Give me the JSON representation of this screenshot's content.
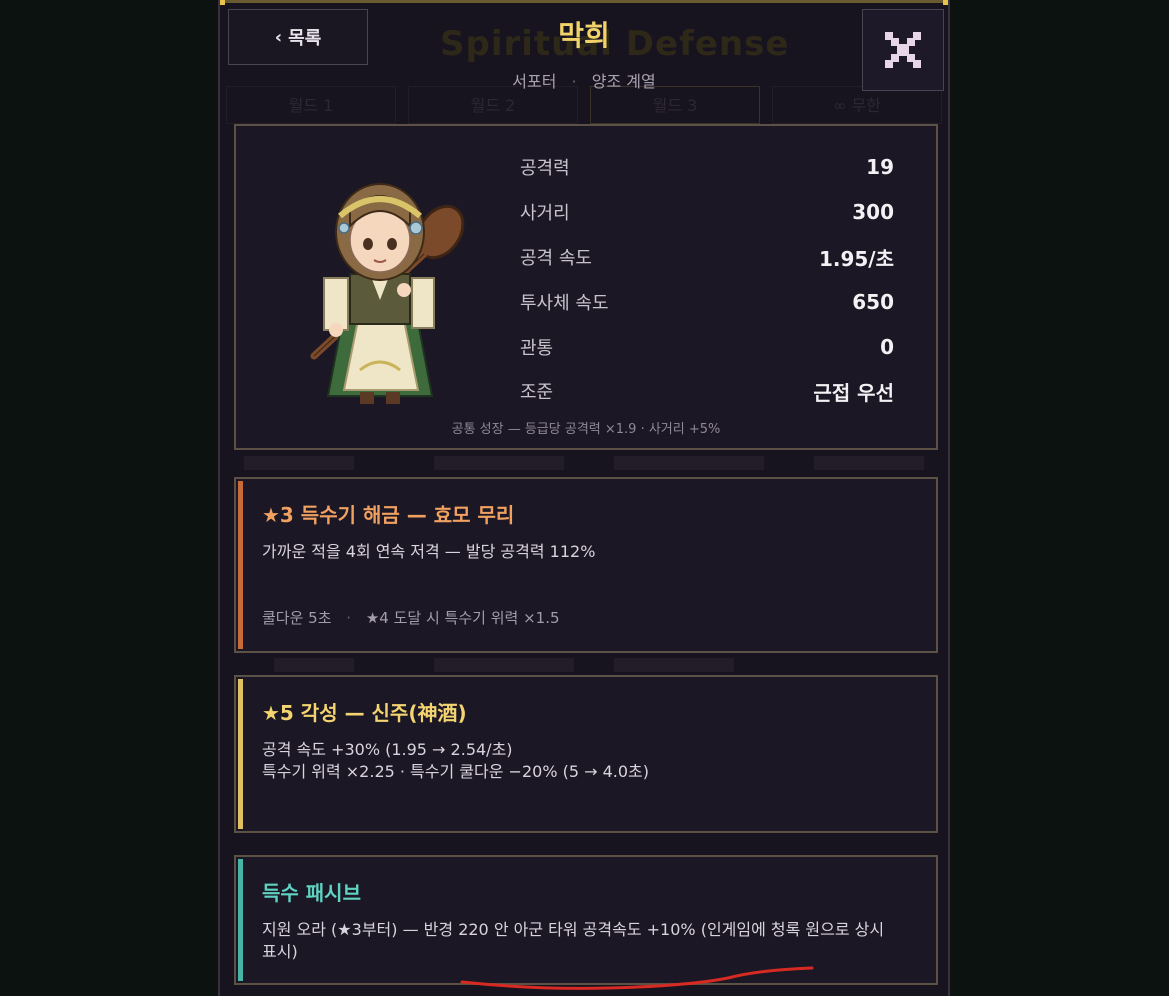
{
  "background_ui": {
    "title": "Spiritual Defense",
    "tabs": [
      "월드 1",
      "월드 2",
      "월드 3",
      "∞ 무한"
    ]
  },
  "header": {
    "back_label": "목록",
    "back_icon": "chevron-left-icon",
    "close_icon": "close-x-icon",
    "character_name": "막희",
    "character_subtitle_role": "서포터",
    "character_subtitle_lineage": "양조 계열"
  },
  "stats": {
    "rows": [
      {
        "label": "공격력",
        "value": "19"
      },
      {
        "label": "사거리",
        "value": "300"
      },
      {
        "label": "공격 속도",
        "value": "1.95/초"
      },
      {
        "label": "투사체 속도",
        "value": "650"
      },
      {
        "label": "관통",
        "value": "0"
      },
      {
        "label": "조준",
        "value": "근접 우선"
      }
    ],
    "footer": "공통 성장 — 등급당 공격력 ×1.9 · 사거리 +5%"
  },
  "skills": [
    {
      "title": "★3 득수기 해금 — 효모 무리",
      "desc": "가까운 적을 4회 연속 저격 — 발당 공격력 112%",
      "meta_cooldown": "쿨다운 5초",
      "meta_note": "★4 도달 시 특수기 위력 ×1.5",
      "accent_color": "#c96a3a",
      "title_color": "#f0a060"
    },
    {
      "title": "★5 각성 — 신주(神酒)",
      "desc_line1": "공격 속도 +30%  (1.95 → 2.54/초)",
      "desc_line2": "특수기 위력 ×2.25 · 특수기 쿨다운 −20% (5 → 4.0초)",
      "accent_color": "#e0c060",
      "title_color": "#f3d470"
    },
    {
      "title": "득수 패시브",
      "desc": "지원 오라 (★3부터) — 반경 220 안 아군 타워 공격속도 +10% (인게임에 청록 원으로 상시 표시)",
      "accent_color": "#49b3a6",
      "title_color": "#5fd2c2"
    }
  ],
  "colors": {
    "accent_gold": "#f1d36a",
    "panel_bg": "#17131f",
    "card_border": "#5b5144",
    "annotation_red": "#d62a22"
  }
}
